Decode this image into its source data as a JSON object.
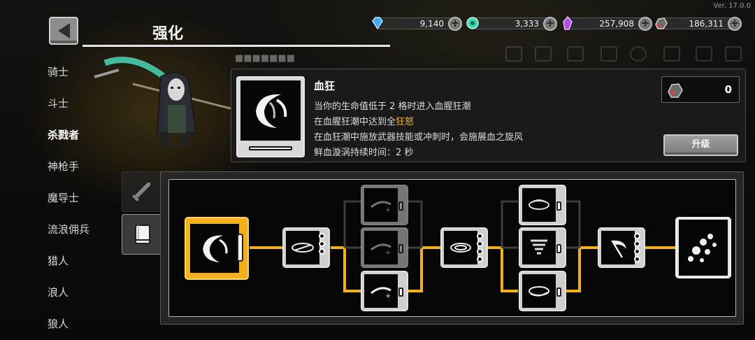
{
  "version": "Ver. 17.0.0",
  "header": {
    "title": "强化",
    "back_icon": "back-arrow-icon"
  },
  "currencies": [
    {
      "name": "gem",
      "value": "9,140",
      "color": "#3ea8ff"
    },
    {
      "name": "token",
      "value": "3,333",
      "color": "#3fd6b0"
    },
    {
      "name": "crystal",
      "value": "257,908",
      "color": "#b04ce0"
    },
    {
      "name": "ore",
      "value": "186,311",
      "color": "#c84a4a"
    }
  ],
  "classes": [
    {
      "label": "骑士",
      "active": false
    },
    {
      "label": "斗士",
      "active": false
    },
    {
      "label": "杀戮者",
      "active": true
    },
    {
      "label": "神枪手",
      "active": false
    },
    {
      "label": "魔导士",
      "active": false
    },
    {
      "label": "流浪佣兵",
      "active": false
    },
    {
      "label": "猎人",
      "active": false
    },
    {
      "label": "浪人",
      "active": false
    },
    {
      "label": "狼人",
      "active": false
    }
  ],
  "skill": {
    "name": "血狂",
    "lines": [
      "当你的生命值低于 2 格时进入血腥狂潮",
      "在血腥狂潮中达到全",
      "在血狂潮中施放武器技能或冲刺时，会施展血之旋风",
      "鲜血漩涡持续时间：2 秒"
    ],
    "highlight": "狂怒",
    "highlight_color": "#f6b81e",
    "cost": "0",
    "upgrade_label": "升级"
  },
  "tabs": [
    {
      "name": "weapon",
      "icon": "sword-icon",
      "active": false
    },
    {
      "name": "book",
      "icon": "book-icon",
      "active": true
    }
  ],
  "tree": {
    "active_color": "#f2b01e",
    "inactive_color": "#3c3c3c"
  }
}
